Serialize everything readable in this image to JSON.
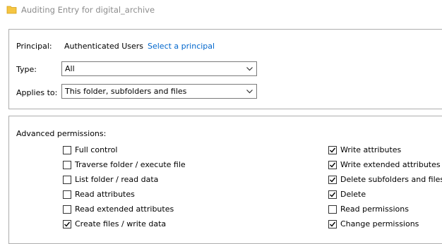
{
  "window": {
    "title": "Auditing Entry for digital_archive"
  },
  "principal": {
    "label": "Principal:",
    "value": "Authenticated Users",
    "link": "Select a principal"
  },
  "type": {
    "label": "Type:",
    "value": "All"
  },
  "applies_to": {
    "label": "Applies to:",
    "value": "This folder, subfolders and files"
  },
  "advanced": {
    "heading": "Advanced permissions:",
    "left": [
      {
        "label": "Full control",
        "checked": false
      },
      {
        "label": "Traverse folder / execute file",
        "checked": false
      },
      {
        "label": "List folder / read data",
        "checked": false
      },
      {
        "label": "Read attributes",
        "checked": false
      },
      {
        "label": "Read extended attributes",
        "checked": false
      },
      {
        "label": "Create files / write data",
        "checked": true
      }
    ],
    "right": [
      {
        "label": "Write attributes",
        "checked": true
      },
      {
        "label": "Write extended attributes",
        "checked": true
      },
      {
        "label": "Delete subfolders and files",
        "checked": true
      },
      {
        "label": "Delete",
        "checked": true
      },
      {
        "label": "Read permissions",
        "checked": false
      },
      {
        "label": "Change permissions",
        "checked": true
      }
    ]
  },
  "colors": {
    "link": "#0066cc",
    "folder": "#f5c542",
    "border": "#adadad"
  },
  "icons": {
    "title": "folder-icon",
    "combo": "chevron-down-icon",
    "check": "checkmark-icon"
  }
}
